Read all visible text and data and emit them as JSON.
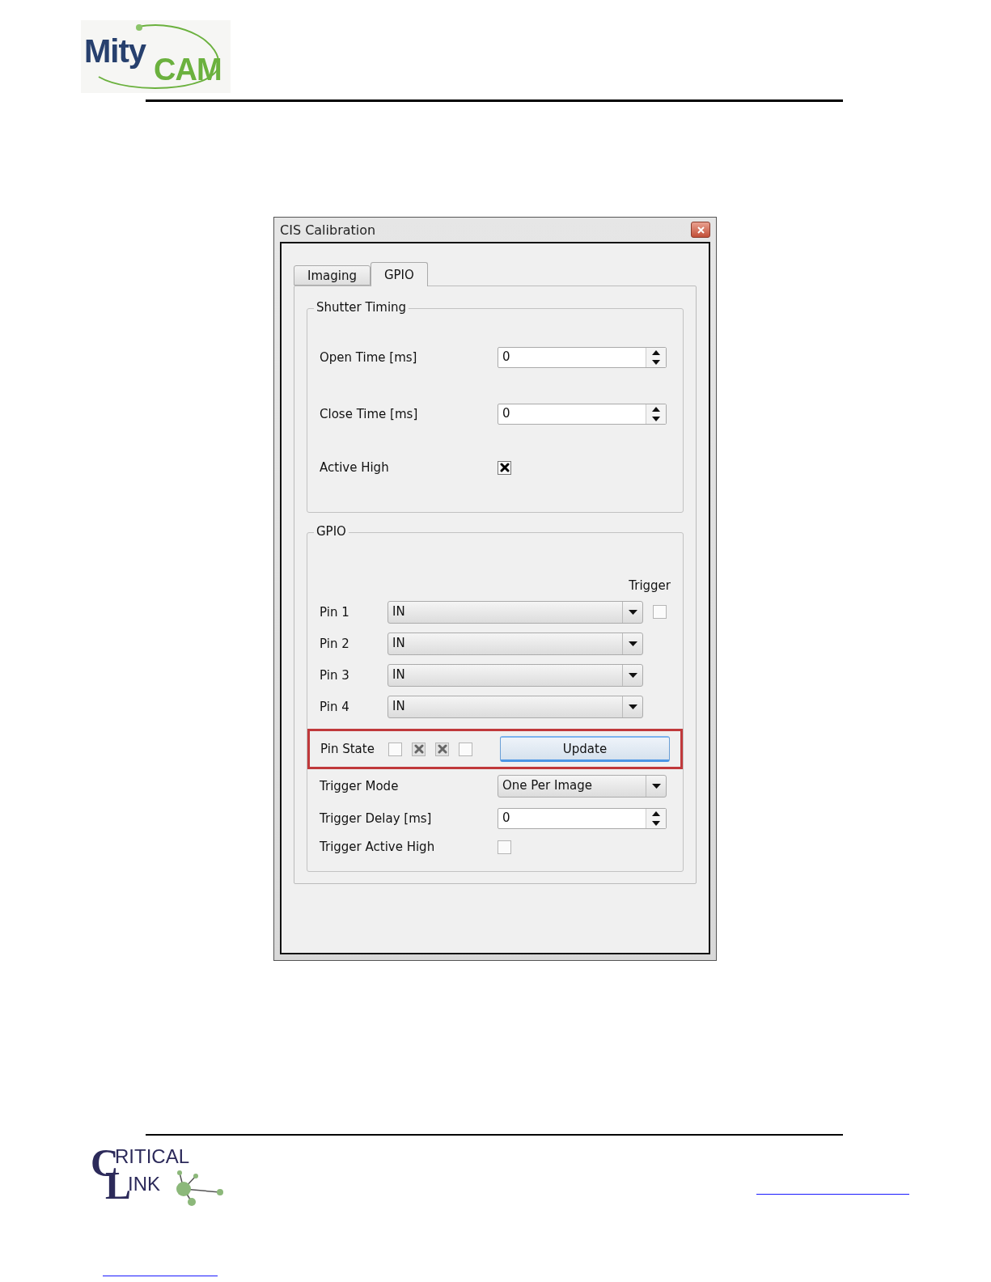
{
  "header_logo": {
    "word_1": "Mity",
    "word_2": "CAM"
  },
  "dialog": {
    "title": "CIS Calibration",
    "tabs": [
      {
        "label": "Imaging",
        "selected": false
      },
      {
        "label": "GPIO",
        "selected": true
      }
    ],
    "shutter_timing": {
      "title": "Shutter Timing",
      "open_time": {
        "label": "Open Time [ms]",
        "value": "0"
      },
      "close_time": {
        "label": "Close Time [ms]",
        "value": "0"
      },
      "active_high": {
        "label": "Active High",
        "checked": true
      }
    },
    "gpio": {
      "title": "GPIO",
      "trigger_heading": "Trigger",
      "pins": [
        {
          "label": "Pin 1",
          "value": "IN",
          "trigger": false
        },
        {
          "label": "Pin 2",
          "value": "IN"
        },
        {
          "label": "Pin 3",
          "value": "IN"
        },
        {
          "label": "Pin 4",
          "value": "IN"
        }
      ],
      "pin_state": {
        "label": "Pin State",
        "states": [
          {
            "checked": false
          },
          {
            "checked": true
          },
          {
            "checked": true
          },
          {
            "checked": false
          }
        ],
        "button": "Update",
        "highlighted": true
      },
      "trigger_mode": {
        "label": "Trigger Mode",
        "value": "One Per Image"
      },
      "trigger_delay": {
        "label": "Trigger Delay [ms]",
        "value": "0"
      },
      "trigger_active_high": {
        "label": "Trigger Active High",
        "checked": false
      }
    }
  },
  "footer_logo": {
    "word_1": "RITICAL",
    "word_2": "INK",
    "initial_1": "C",
    "initial_2": "L"
  }
}
